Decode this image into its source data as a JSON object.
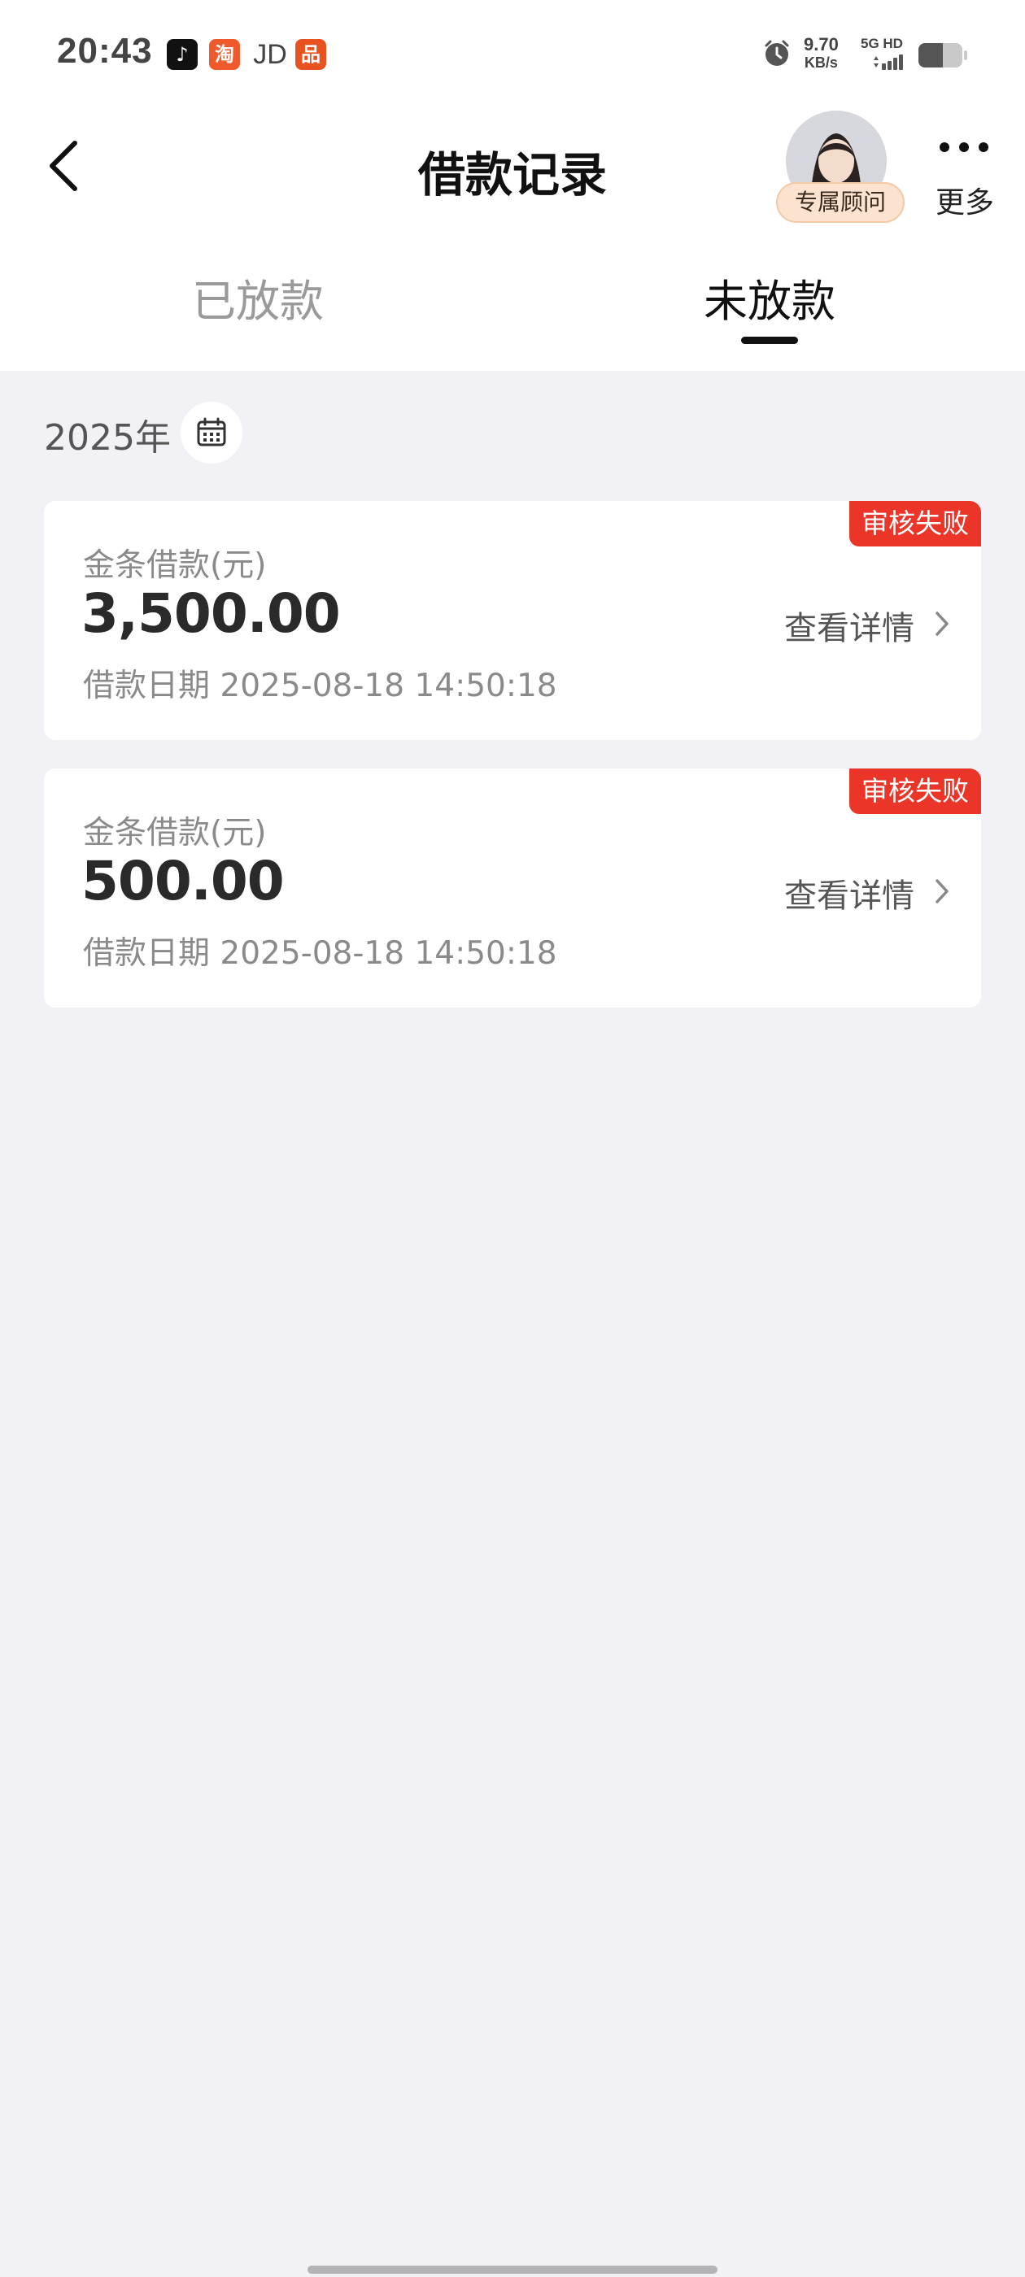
{
  "status_bar": {
    "time": "20:43",
    "apps": [
      {
        "name": "douyin-icon",
        "glyph": "♪"
      },
      {
        "name": "taobao-icon",
        "glyph": "淘"
      },
      {
        "name": "jd-icon",
        "glyph": "JD"
      },
      {
        "name": "pinduoduo-icon",
        "glyph": "品"
      }
    ],
    "net_speed": "9.70",
    "net_speed_unit": "KB/s",
    "network_type": "5G HD"
  },
  "header": {
    "title": "借款记录",
    "advisor_label": "专属顾问",
    "more_label": "更多"
  },
  "tabs": [
    {
      "label": "已放款",
      "active": false
    },
    {
      "label": "未放款",
      "active": true
    }
  ],
  "filter": {
    "year": "2025年"
  },
  "records": [
    {
      "status": "审核失败",
      "label": "金条借款(元)",
      "amount": "3,500.00",
      "date": "借款日期 2025-08-18 14:50:18",
      "detail_label": "查看详情"
    },
    {
      "status": "审核失败",
      "label": "金条借款(元)",
      "amount": "500.00",
      "date": "借款日期 2025-08-18 14:50:18",
      "detail_label": "查看详情"
    }
  ],
  "colors": {
    "accent_red": "#ea3528",
    "background": "#f2f1f6",
    "advisor_badge": "#fbe3cf"
  }
}
